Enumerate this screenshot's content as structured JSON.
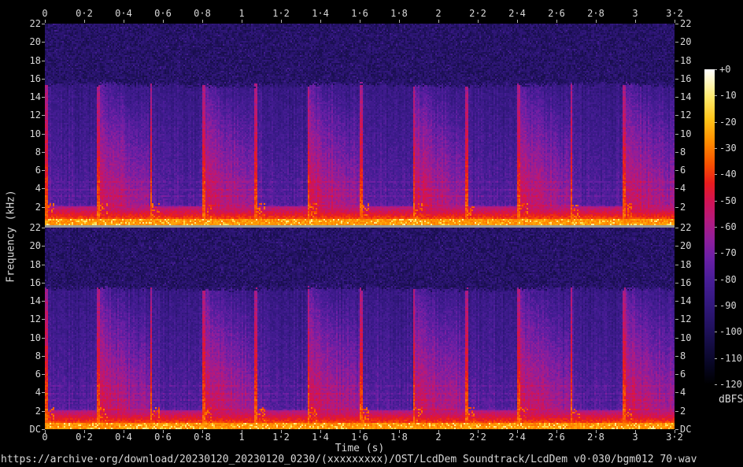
{
  "title": "https://archive·org/download/20230120_20230120_0230/(xxxxxxxxx)/OST/LcdDem Soundtrack/LcdDem v0·030/bgm012 70·wav",
  "axes": {
    "time_label": "Time (s)",
    "freq_label": "Frequency (kHz)",
    "time_ticks": [
      "0",
      "0·2",
      "0·4",
      "0·6",
      "0·8",
      "1",
      "1·2",
      "1·4",
      "1·6",
      "1·8",
      "2",
      "2·2",
      "2·4",
      "2·6",
      "2·8",
      "3",
      "3·2"
    ],
    "freq_ticks_channel": [
      "22",
      "20",
      "18",
      "16",
      "14",
      "12",
      "10",
      "8",
      "6",
      "4",
      "2"
    ],
    "dc_label": "DC"
  },
  "colorbar": {
    "unit": "dBFS",
    "tick_labels": [
      "+0",
      "-10",
      "-20",
      "-30",
      "-40",
      "-50",
      "-60",
      "-70",
      "-80",
      "-90",
      "-100",
      "-110",
      "-120"
    ]
  },
  "chart_data": {
    "type": "heatmap",
    "subtype": "stereo-audio-spectrogram",
    "channels": 2,
    "channel_order": [
      "left",
      "right"
    ],
    "time_range_s": [
      0,
      3.2
    ],
    "freq_range_khz": [
      0,
      22
    ],
    "db_range": [
      -120,
      0
    ],
    "lowpass_cutoff_khz": 15.3,
    "beat_period_s": 0.267,
    "onsets_s": [
      0.0,
      0.27,
      0.53,
      0.8,
      1.07,
      1.34,
      1.6,
      1.87,
      2.14,
      2.41,
      2.67,
      2.94
    ],
    "bright_segment_starts_s": [
      0.27,
      0.8,
      1.34,
      1.87,
      2.41,
      2.94
    ],
    "bass_red_band_khz": [
      0,
      2.1
    ],
    "dc_yellow_band_khz": [
      0,
      0.62
    ],
    "harmonics_khz": [
      0.85,
      1.1,
      1.4,
      1.7,
      2.1,
      2.6,
      3.2,
      3.9,
      4.7
    ],
    "noise_floor_db": -100,
    "dark_segment_body_db": -85,
    "bright_segment_peak_db": -55,
    "attack_line_low_db": -33,
    "dc_band_db": -22,
    "text_color": "#d8d8d8",
    "background": "#000000",
    "separator_color": "#989898",
    "palette": [
      [
        0.0,
        "#000000"
      ],
      [
        0.06,
        "#070622"
      ],
      [
        0.13,
        "#150d45"
      ],
      [
        0.19,
        "#231263"
      ],
      [
        0.26,
        "#33187f"
      ],
      [
        0.33,
        "#471d96"
      ],
      [
        0.4,
        "#6a1fa5"
      ],
      [
        0.46,
        "#8f1e9b"
      ],
      [
        0.52,
        "#b31a7e"
      ],
      [
        0.58,
        "#d11355"
      ],
      [
        0.64,
        "#e91c1c"
      ],
      [
        0.7,
        "#f85200"
      ],
      [
        0.77,
        "#ff8c00"
      ],
      [
        0.84,
        "#ffc318"
      ],
      [
        0.91,
        "#ffe96a"
      ],
      [
        0.96,
        "#fff7c0"
      ],
      [
        1.0,
        "#ffffff"
      ]
    ]
  }
}
